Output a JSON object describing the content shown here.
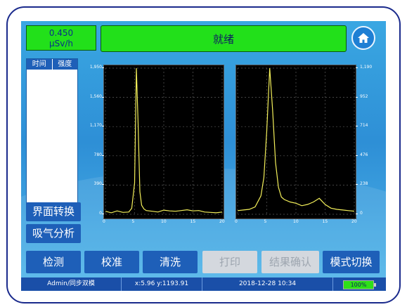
{
  "header": {
    "dose_value": "0.450",
    "dose_unit": "μSv/h",
    "status_text": "就绪",
    "home_icon": "home-icon"
  },
  "list": {
    "columns": [
      "时间",
      "强度"
    ]
  },
  "side_buttons": {
    "interface_switch": "界面转换",
    "breath_analysis": "吸气分析"
  },
  "chart_data": [
    {
      "type": "line",
      "title": "",
      "xlabel": "",
      "ylabel": "",
      "xlim": [
        0,
        20
      ],
      "ylim": [
        0,
        1950
      ],
      "x_ticks": [
        "0",
        "5",
        "10",
        "15",
        "20"
      ],
      "y_ticks": [
        "1,950",
        "1,560",
        "1,170",
        "780",
        "390",
        "0"
      ],
      "series": [
        {
          "color": "#f4f05a",
          "x": [
            0,
            1,
            2,
            3,
            4,
            4.5,
            5,
            5.3,
            5.6,
            5.9,
            6.2,
            6.6,
            7,
            8,
            9,
            10,
            11,
            12,
            13,
            14,
            15,
            16,
            17,
            18,
            19,
            20
          ],
          "y": [
            40,
            20,
            45,
            25,
            30,
            80,
            420,
            1950,
            1200,
            300,
            120,
            70,
            50,
            40,
            30,
            55,
            45,
            40,
            50,
            60,
            45,
            50,
            30,
            25,
            20,
            30
          ]
        }
      ]
    },
    {
      "type": "line",
      "title": "",
      "xlabel": "",
      "ylabel": "",
      "xlim": [
        0,
        20
      ],
      "ylim": [
        0,
        1190
      ],
      "x_ticks": [
        "0",
        "5",
        "10",
        "15",
        "20"
      ],
      "y_ticks": [
        "1,190",
        "952",
        "714",
        "476",
        "238",
        "0"
      ],
      "series": [
        {
          "color": "#f4f05a",
          "x": [
            0,
            1,
            2,
            3,
            4,
            4.5,
            5,
            5.5,
            6,
            6.5,
            7,
            7.5,
            8,
            9,
            10,
            11,
            12,
            13,
            14,
            15,
            16,
            17,
            18,
            19,
            20
          ],
          "y": [
            30,
            35,
            40,
            60,
            150,
            300,
            680,
            1190,
            850,
            420,
            220,
            140,
            120,
            100,
            90,
            70,
            80,
            100,
            130,
            80,
            50,
            40,
            35,
            30,
            25
          ]
        }
      ]
    }
  ],
  "bottom_buttons": {
    "detect": "检测",
    "calibrate": "校准",
    "clean": "清洗",
    "print": "打印",
    "confirm_result": "结果确认",
    "mode_switch": "模式切换"
  },
  "statusbar": {
    "user": "Admin/同步双模",
    "coords": "x:5.96 y:1193.91",
    "datetime": "2018-12-28 10:34",
    "battery": "100%"
  },
  "colors": {
    "status_green": "#22e01a",
    "button_blue": "#1e5fb8",
    "trace_yellow": "#f4f05a"
  }
}
